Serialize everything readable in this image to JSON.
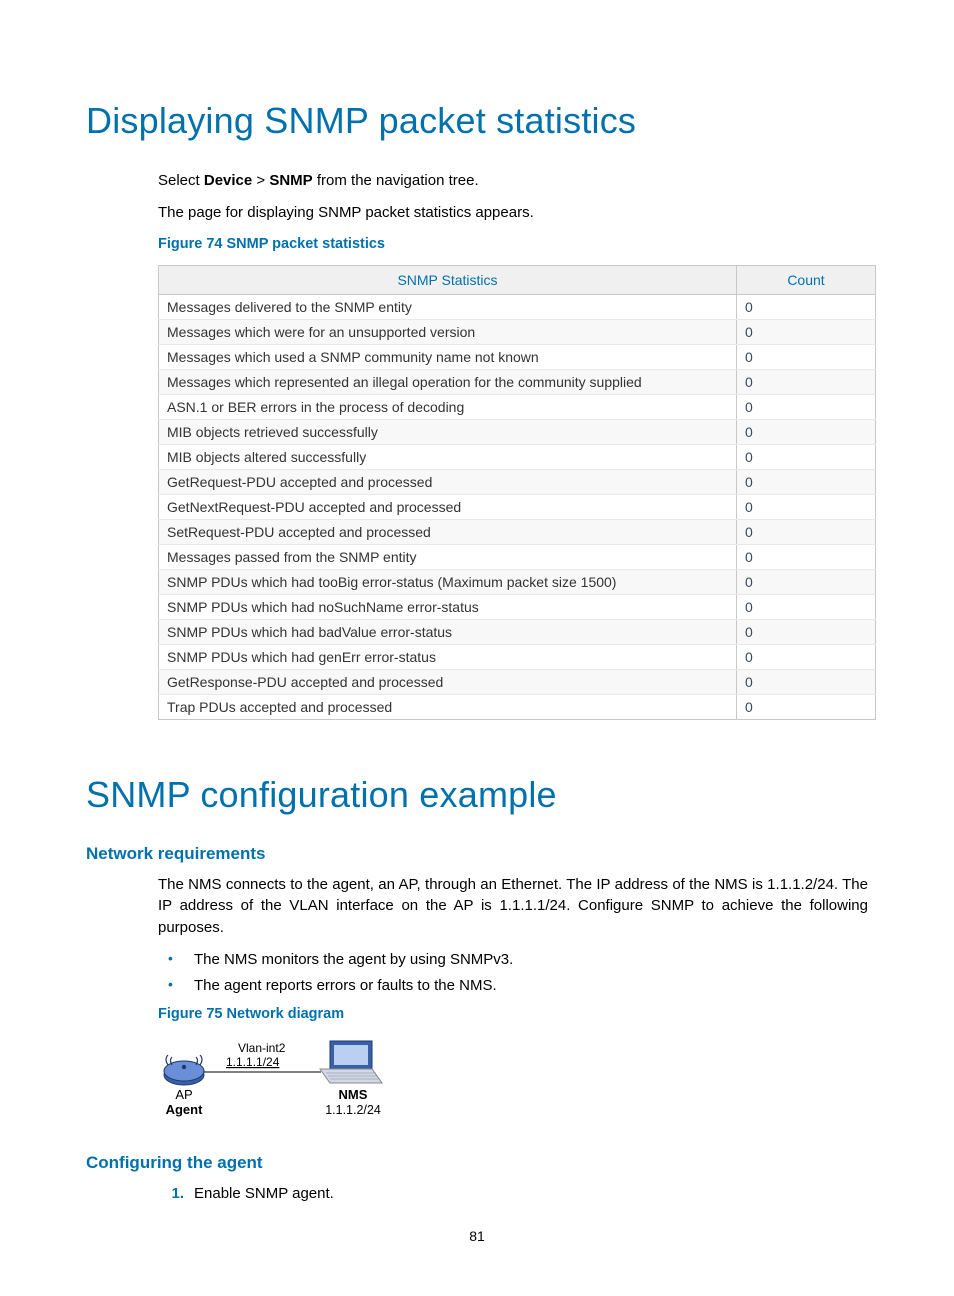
{
  "heading1": "Displaying SNMP packet statistics",
  "intro": {
    "line1_pre": "Select ",
    "line1_bold1": "Device",
    "line1_mid": " > ",
    "line1_bold2": "SNMP",
    "line1_post": " from the navigation tree.",
    "line2": "The page for displaying SNMP packet statistics appears.",
    "fig74": "Figure 74 SNMP packet statistics"
  },
  "table": {
    "headers": {
      "stat": "SNMP Statistics",
      "count": "Count"
    },
    "rows": [
      {
        "stat": "Messages delivered to the SNMP entity",
        "count": "0"
      },
      {
        "stat": "Messages which were for an unsupported version",
        "count": "0"
      },
      {
        "stat": "Messages which used a SNMP community name not known",
        "count": "0"
      },
      {
        "stat": "Messages which represented an illegal operation for the community supplied",
        "count": "0"
      },
      {
        "stat": "ASN.1 or BER errors in the process of decoding",
        "count": "0"
      },
      {
        "stat": "MIB objects retrieved successfully",
        "count": "0"
      },
      {
        "stat": "MIB objects altered successfully",
        "count": "0"
      },
      {
        "stat": "GetRequest-PDU accepted and processed",
        "count": "0"
      },
      {
        "stat": "GetNextRequest-PDU accepted and processed",
        "count": "0"
      },
      {
        "stat": "SetRequest-PDU accepted and processed",
        "count": "0"
      },
      {
        "stat": "Messages passed from the SNMP entity",
        "count": "0"
      },
      {
        "stat": "SNMP PDUs which had tooBig error-status (Maximum packet size 1500)",
        "count": "0"
      },
      {
        "stat": "SNMP PDUs which had noSuchName error-status",
        "count": "0"
      },
      {
        "stat": "SNMP PDUs which had badValue error-status",
        "count": "0"
      },
      {
        "stat": "SNMP PDUs which had genErr error-status",
        "count": "0"
      },
      {
        "stat": "GetResponse-PDU accepted and processed",
        "count": "0"
      },
      {
        "stat": "Trap PDUs accepted and processed",
        "count": "0"
      }
    ]
  },
  "heading2": "SNMP configuration example",
  "netreq": {
    "title": "Network requirements",
    "para": "The NMS connects to the agent, an AP, through an Ethernet. The IP address of the NMS is 1.1.1.2/24. The IP address of the VLAN interface on the AP is 1.1.1.1/24. Configure SNMP to achieve the following purposes.",
    "bullets": [
      "The NMS monitors the agent by using SNMPv3.",
      "The agent reports errors or faults to the NMS."
    ],
    "fig75": "Figure 75 Network diagram"
  },
  "diagram": {
    "vlan_label": "Vlan-int2",
    "ap_ip": "1.1.1.1/24",
    "ap_label1": "AP",
    "ap_label2": "Agent",
    "nms_label": "NMS",
    "nms_ip": "1.1.1.2/24"
  },
  "configagent": {
    "title": "Configuring the agent",
    "step1_num": "1.",
    "step1_text": "Enable SNMP agent."
  },
  "page_number": "81"
}
